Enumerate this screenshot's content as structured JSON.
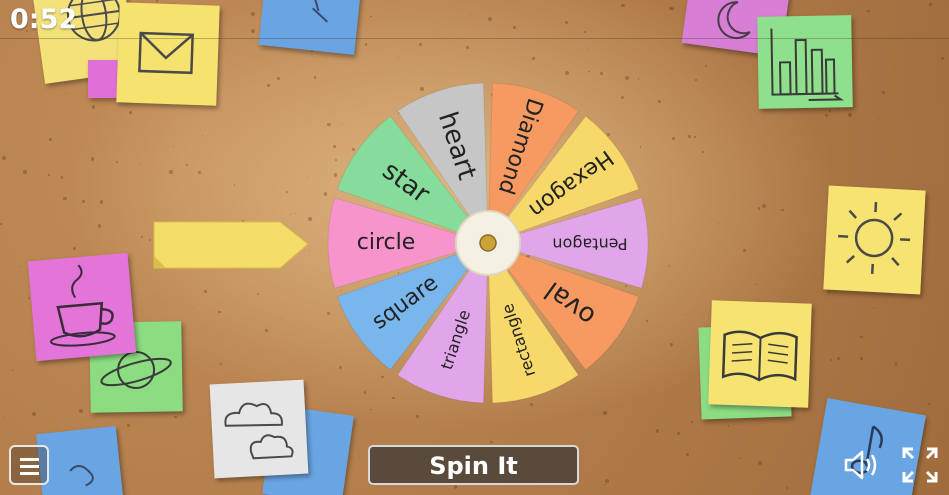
{
  "timer": "0:52",
  "wheel": {
    "segments": [
      {
        "label": "Hexagon",
        "color": "#f7d86a"
      },
      {
        "label": "Pentagon",
        "color": "#e1a6ea"
      },
      {
        "label": "oval",
        "color": "#f79a62"
      },
      {
        "label": "rectangle",
        "color": "#f7d86a"
      },
      {
        "label": "triangle",
        "color": "#e1a6ea"
      },
      {
        "label": "square",
        "color": "#79b6ec"
      },
      {
        "label": "circle",
        "color": "#f694cb"
      },
      {
        "label": "star",
        "color": "#86dc9b"
      },
      {
        "label": "heart",
        "color": "#c6c6c6"
      },
      {
        "label": "Diamond",
        "color": "#f79a62"
      }
    ],
    "hub_icon": "wheel-hub-icon"
  },
  "controls": {
    "spin_label": "Spin It",
    "menu_icon": "hamburger-menu-icon",
    "sound_icon": "speaker-icon",
    "fullscreen_icon": "fullscreen-icon"
  },
  "decor": {
    "notes": [
      "globe-icon",
      "envelope-icon",
      "moon-icon",
      "bar-chart-icon",
      "sun-icon",
      "teacup-icon",
      "planet-icon",
      "cloud-icon",
      "book-icon",
      "music-note-icon"
    ]
  },
  "colors": {
    "board": "#b07a48",
    "pointer": "#f5dd6a"
  }
}
